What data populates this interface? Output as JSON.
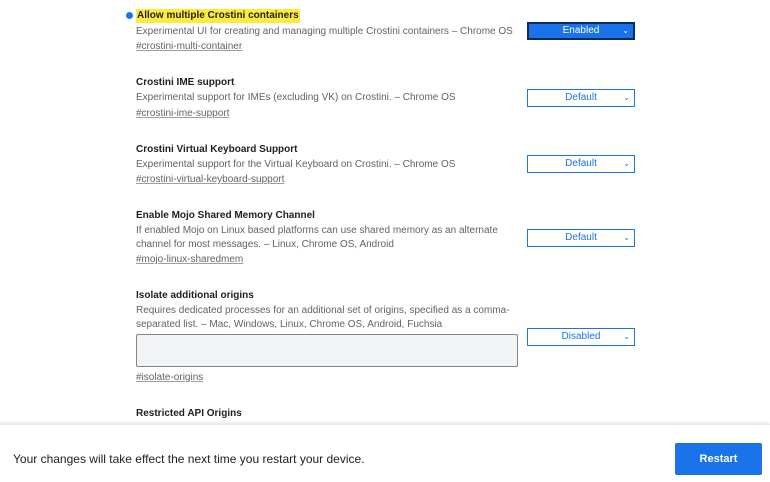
{
  "flags": [
    {
      "title": "Allow multiple Crostini containers",
      "description": "Experimental UI for creating and managing multiple Crostini containers – Chrome OS",
      "tag": "#crostini-multi-container",
      "value": "Enabled"
    },
    {
      "title": "Crostini IME support",
      "description": "Experimental support for IMEs (excluding VK) on Crostini. – Chrome OS",
      "tag": "#crostini-ime-support",
      "value": "Default"
    },
    {
      "title": "Crostini Virtual Keyboard Support",
      "description": "Experimental support for the Virtual Keyboard on Crostini. – Chrome OS",
      "tag": "#crostini-virtual-keyboard-support",
      "value": "Default"
    },
    {
      "title": "Enable Mojo Shared Memory Channel",
      "description": "If enabled Mojo on Linux based platforms can use shared memory as an alternate channel for most messages. – Linux, Chrome OS, Android",
      "tag": "#mojo-linux-sharedmem",
      "value": "Default"
    },
    {
      "title": "Isolate additional origins",
      "description": "Requires dedicated processes for an additional set of origins, specified as a comma-separated list. – Mac, Windows, Linux, Chrome OS, Android, Fuchsia",
      "tag": "#isolate-origins",
      "value": "Disabled",
      "textarea_value": ""
    },
    {
      "title": "Restricted API Origins"
    }
  ],
  "footer": {
    "message": "Your changes will take effect the next time you restart your device.",
    "restart_label": "Restart"
  },
  "colors": {
    "accent": "#1a73e8",
    "highlight": "#ffeb3b"
  }
}
